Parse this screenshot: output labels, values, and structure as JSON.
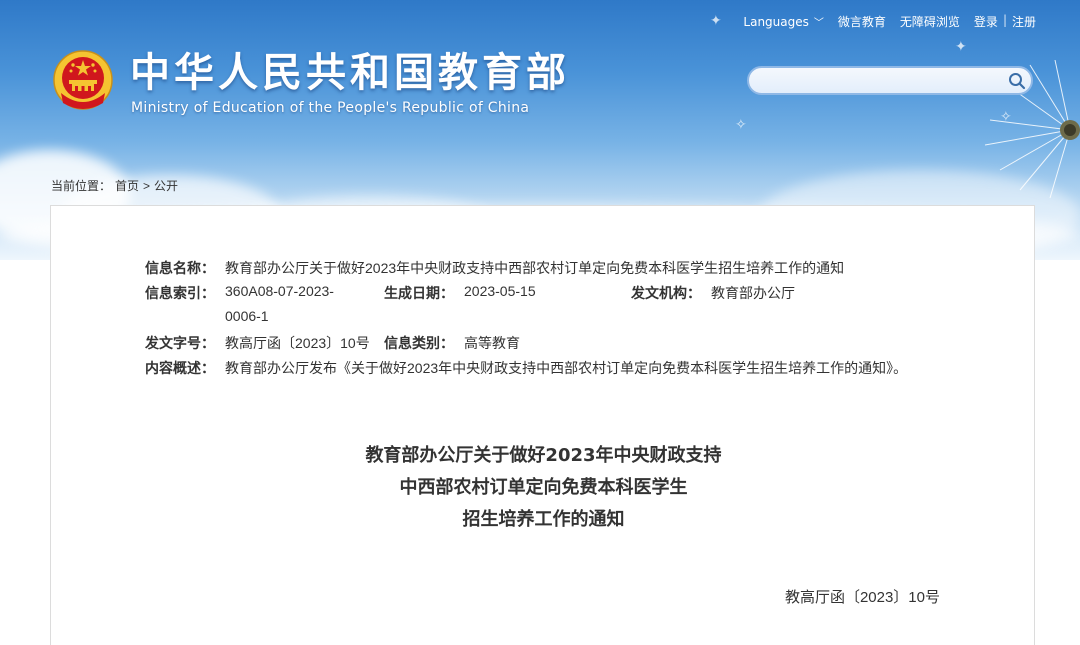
{
  "header": {
    "title": "中华人民共和国教育部",
    "subtitle": "Ministry of Education of the People's Republic of China",
    "emblem_icon": "national-emblem-icon"
  },
  "topnav": {
    "languages": "Languages",
    "wechat": "微言教育",
    "accessibility": "无障碍浏览",
    "login": "登录",
    "separator": "|",
    "register": "注册"
  },
  "search": {
    "placeholder": "",
    "value": "",
    "icon": "search-icon"
  },
  "breadcrumb": {
    "prefix": "当前位置：",
    "home": "首页",
    "separator": ">",
    "current": "公开"
  },
  "meta": {
    "name_label": "信息名称：",
    "name_value": "教育部办公厅关于做好2023年中央财政支持中西部农村订单定向免费本科医学生招生培养工作的通知",
    "index_label": "信息索引：",
    "index_value_line1": "360A08-07-2023-",
    "index_value_line2": "0006-1",
    "date_label": "生成日期：",
    "date_value": "2023-05-15",
    "agency_label": "发文机构：",
    "agency_value": "教育部办公厅",
    "docno_label": "发文字号：",
    "docno_value": "教高厅函〔2023〕10号",
    "category_label": "信息类别：",
    "category_value": "高等教育",
    "summary_label": "内容概述：",
    "summary_value": "教育部办公厅发布《关于做好2023年中央财政支持中西部农村订单定向免费本科医学生招生培养工作的通知》。"
  },
  "document": {
    "title_line1": "教育部办公厅关于做好2023年中央财政支持",
    "title_line2": "中西部农村订单定向免费本科医学生",
    "title_line3": "招生培养工作的通知",
    "number": "教高厅函〔2023〕10号"
  },
  "colors": {
    "sky_top": "#2f79c8",
    "sky_bottom": "#eef6fd",
    "text": "#333333",
    "emblem_red": "#d0171d",
    "emblem_gold": "#f5c431"
  }
}
